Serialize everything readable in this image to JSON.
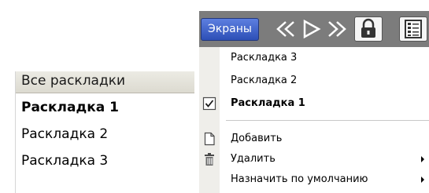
{
  "left_panel": {
    "header": "Все раскладки",
    "items": [
      {
        "label": "Раскладка 1",
        "bold": true
      },
      {
        "label": "Раскладка 2",
        "bold": false
      },
      {
        "label": "Раскладка 3",
        "bold": false
      }
    ]
  },
  "toolbar": {
    "screens_button": "Экраны",
    "icons": [
      "rewind-icon",
      "play-icon",
      "fast-forward-icon",
      "lock-icon",
      "layout-list-icon"
    ]
  },
  "menu": {
    "layouts": [
      {
        "label": "Раскладка 3",
        "checked": false,
        "bold": false
      },
      {
        "label": "Раскладка 2",
        "checked": false,
        "bold": false
      },
      {
        "label": "Раскладка 1",
        "checked": true,
        "bold": true
      }
    ],
    "actions": [
      {
        "label": "Добавить",
        "icon": "document-icon",
        "submenu": false
      },
      {
        "label": "Удалить",
        "icon": "trash-icon",
        "submenu": true
      },
      {
        "label": "Назначить по умолчанию",
        "icon": "",
        "submenu": true
      }
    ]
  },
  "colors": {
    "toolbar_bg": "#7c7c7c",
    "screens_button": "#3a5cc8",
    "menu_gutter": "#efeeea"
  }
}
